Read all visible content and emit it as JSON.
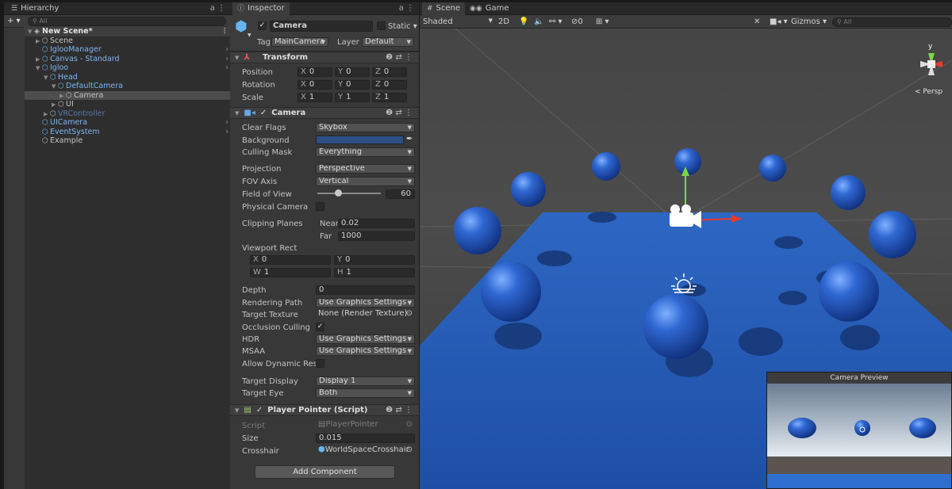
{
  "hierarchy": {
    "tab_label": "Hierarchy",
    "add_label": "+ ▾",
    "search_placeholder": "All",
    "items": [
      {
        "label": "New Scene*",
        "depth": 0,
        "type": "scene"
      },
      {
        "label": "Scene",
        "depth": 1,
        "type": "object"
      },
      {
        "label": "IglooManager",
        "depth": 1,
        "type": "prefab"
      },
      {
        "label": "Canvas - Standard",
        "depth": 1,
        "type": "prefab"
      },
      {
        "label": "Igloo",
        "depth": 1,
        "type": "prefab"
      },
      {
        "label": "Head",
        "depth": 2,
        "type": "prefab"
      },
      {
        "label": "DefaultCamera",
        "depth": 3,
        "type": "prefab"
      },
      {
        "label": "Camera",
        "depth": 4,
        "type": "object"
      },
      {
        "label": "UI",
        "depth": 3,
        "type": "object"
      },
      {
        "label": "VRController",
        "depth": 2,
        "type": "dim"
      },
      {
        "label": "UICamera",
        "depth": 1,
        "type": "prefab"
      },
      {
        "label": "EventSystem",
        "depth": 1,
        "type": "prefab"
      },
      {
        "label": "Example",
        "depth": 1,
        "type": "object"
      }
    ]
  },
  "inspector": {
    "tab_label": "Inspector",
    "object_name": "Camera",
    "static_label": "Static",
    "tag_label": "Tag",
    "tag_value": "MainCamera",
    "layer_label": "Layer",
    "layer_value": "Default",
    "transform": {
      "title": "Transform",
      "rows": [
        {
          "label": "Position",
          "x": "0",
          "y": "0",
          "z": "0"
        },
        {
          "label": "Rotation",
          "x": "0",
          "y": "0",
          "z": "0"
        },
        {
          "label": "Scale",
          "x": "1",
          "y": "1",
          "z": "1"
        }
      ]
    },
    "camera": {
      "title": "Camera",
      "clear_flags_label": "Clear Flags",
      "clear_flags": "Skybox",
      "background_label": "Background",
      "background_color": "#2e4f86",
      "culling_mask_label": "Culling Mask",
      "culling_mask": "Everything",
      "projection_label": "Projection",
      "projection": "Perspective",
      "fov_axis_label": "FOV Axis",
      "fov_axis": "Vertical",
      "fov_label": "Field of View",
      "fov_value": "60",
      "fov_fraction": 0.33,
      "physical_label": "Physical Camera",
      "clipping_label": "Clipping Planes",
      "near_label": "Near",
      "near_value": "0.02",
      "far_label": "Far",
      "far_value": "1000",
      "viewport_label": "Viewport Rect",
      "vx_label": "X",
      "vx": "0",
      "vy_label": "Y",
      "vy": "0",
      "vw_label": "W",
      "vw": "1",
      "vh_label": "H",
      "vh": "1",
      "depth_label": "Depth",
      "depth": "0",
      "rendering_label": "Rendering Path",
      "rendering": "Use Graphics Settings",
      "target_texture_label": "Target Texture",
      "target_texture": "None (Render Texture)",
      "occlusion_label": "Occlusion Culling",
      "hdr_label": "HDR",
      "hdr": "Use Graphics Settings",
      "msaa_label": "MSAA",
      "msaa": "Use Graphics Settings",
      "dynres_label": "Allow Dynamic Resol",
      "target_display_label": "Target Display",
      "target_display": "Display 1",
      "target_eye_label": "Target Eye",
      "target_eye": "Both"
    },
    "player_pointer": {
      "title": "Player Pointer (Script)",
      "script_label": "Script",
      "script_value": "PlayerPointer",
      "size_label": "Size",
      "size_value": "0.015",
      "crosshair_label": "Crosshair",
      "crosshair_value": "WorldSpaceCrosshair"
    },
    "add_component": "Add Component"
  },
  "scene": {
    "scene_tab": "Scene",
    "game_tab": "Game",
    "shading": "Shaded",
    "mode_2d": "2D",
    "fx_count": "0",
    "gizmos_label": "Gizmos",
    "search_placeholder": "All",
    "persp_label": "< Persp",
    "axis_y": "y",
    "camera_preview_title": "Camera Preview",
    "accent": "#3d73c9"
  }
}
